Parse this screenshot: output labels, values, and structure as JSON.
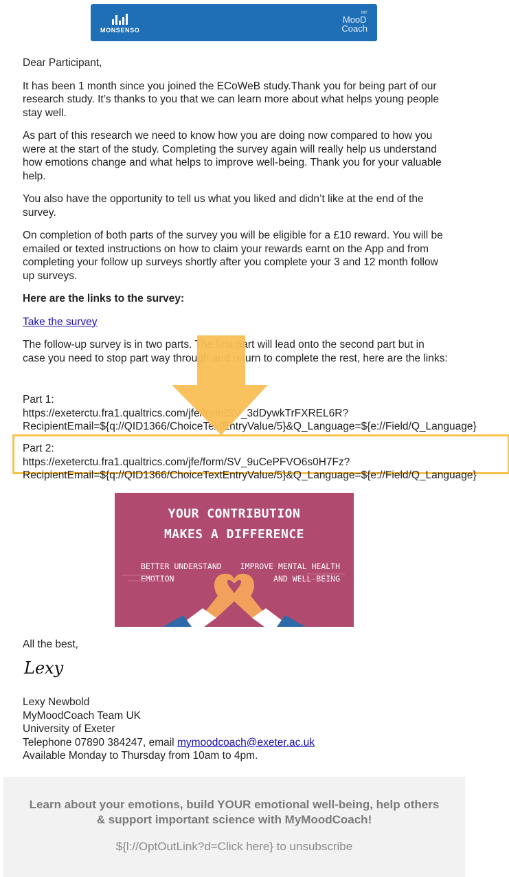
{
  "banner": {
    "brand_left": "MONSENSO",
    "brand_right_small": "MY",
    "brand_right_line1": "MooD",
    "brand_right_line2": "Coach",
    "color": "#1f6fb6"
  },
  "email": {
    "greeting": "Dear Participant,",
    "p1": "It has been 1 month since you joined the ECoWeB study.Thank you for being part of our research study. It’s thanks to you that we can learn more about what helps young people stay well.",
    "p2": "As part of this research we need to know how you are doing now compared to how you were at the start of the study. Completing the survey again will really help us understand how emotions change and what helps to improve well-being. Thank you for your valuable help.",
    "p3": "You also have the opportunity to tell us what you liked and didn’t like at the end of the survey.",
    "p4": "On completion of both parts of the survey you will be eligible for a £10 reward. You will be emailed or texted instructions on how to claim your rewards earnt on the App and from completing your follow up surveys shortly after you complete your 3 and 12 month follow up surveys.",
    "links_heading": "Here are the links to the survey:",
    "survey_link": "Take the survey",
    "p5": "The follow-up survey is in two parts. The first part will lead onto the second part but in case you need to stop part way through and return to complete the rest, here are the links:",
    "part1_label": "Part 1:",
    "part1_url": "https://exeterctu.fra1.qualtrics.com/jfe/form/SV_3dDywkTrFXREL6R?",
    "part1_params": "RecipientEmail=${q://QID1366/ChoiceTextEntryValue/5}&Q_Language=${e://Field/Q_Language}",
    "part2_label": "Part 2:",
    "part2_url": "https://exeterctu.fra1.qualtrics.com/jfe/form/SV_9uCePFVO6s0H7Fz?",
    "part2_params": "RecipientEmail=${q://QID1366/ChoiceTextEntryValue/5}&Q_Language=${e://Field/Q_Language}",
    "highlight_color": "#f7c14d"
  },
  "promo": {
    "line1": "YOUR CONTRIBUTION",
    "line2": "MAKES A DIFFERENCE",
    "left_a": "BETTER UNDERSTAND",
    "left_b": "EMOTION",
    "right_a": "IMPROVE MENTAL HEALTH",
    "right_b": "AND WELL-BEING",
    "bg_color": "#b04a6e"
  },
  "signoff": {
    "closing": "All the best,",
    "signature": "Lexy",
    "name": "Lexy Newbold",
    "team": "MyMoodCoach Team UK",
    "org": "University of Exeter",
    "phone_prefix": "Telephone 07890 384247, email ",
    "email": "mymoodcoach@exeter.ac.uk",
    "hours": "Available Monday to Thursday from 10am to 4pm."
  },
  "footer": {
    "message": "Learn about your emotions, build YOUR emotional well-being, help others & support important science with MyMoodCoach!",
    "unsubscribe": "${l://OptOutLink?d=Click here} to unsubscribe"
  }
}
